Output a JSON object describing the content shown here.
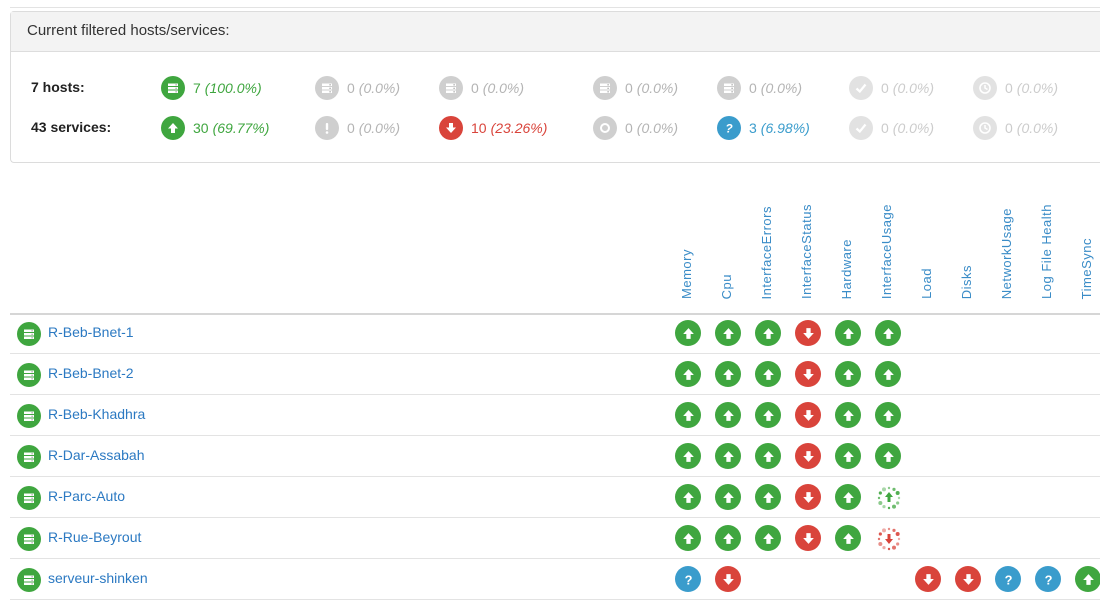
{
  "panel": {
    "heading": "Current filtered hosts/services:",
    "hosts": {
      "label": "7 hosts:",
      "stats": [
        {
          "state": "up",
          "icon": "server-icon",
          "color": "#3fa63f",
          "count": "7",
          "pct": "(100.0%)"
        },
        {
          "state": "down",
          "icon": "server-icon",
          "color": "#cfcfcf",
          "count": "0",
          "pct": "(0.0%)"
        },
        {
          "state": "unreachable",
          "icon": "server-icon",
          "color": "#cfcfcf",
          "count": "0",
          "pct": "(0.0%)"
        },
        {
          "state": "pending",
          "icon": "server-icon",
          "color": "#cfcfcf",
          "count": "0",
          "pct": "(0.0%)"
        },
        {
          "state": "unknown",
          "icon": "server-icon",
          "color": "#cfcfcf",
          "count": "0",
          "pct": "(0.0%)"
        },
        {
          "state": "ack",
          "icon": "check-icon",
          "color": "#e2e2e2",
          "count": "0",
          "pct": "(0.0%)"
        },
        {
          "state": "downtime",
          "icon": "clock-icon",
          "color": "#e2e2e2",
          "count": "0",
          "pct": "(0.0%)"
        }
      ]
    },
    "services": {
      "label": "43 services:",
      "stats": [
        {
          "state": "ok",
          "icon": "arrow-up-icon",
          "color": "#3fa63f",
          "count": "30",
          "pct": "(69.77%)"
        },
        {
          "state": "warning",
          "icon": "exclamation-icon",
          "color": "#cfcfcf",
          "count": "0",
          "pct": "(0.0%)"
        },
        {
          "state": "critical",
          "icon": "arrow-down-icon",
          "color": "#d9443b",
          "count": "10",
          "pct": "(23.26%)"
        },
        {
          "state": "pending",
          "icon": "ring-icon",
          "color": "#cfcfcf",
          "count": "0",
          "pct": "(0.0%)"
        },
        {
          "state": "unknown",
          "icon": "question-icon",
          "color": "#3a9ccc",
          "count": "3",
          "pct": "(6.98%)"
        },
        {
          "state": "ack",
          "icon": "check-icon",
          "color": "#e2e2e2",
          "count": "0",
          "pct": "(0.0%)"
        },
        {
          "state": "downtime",
          "icon": "clock-icon",
          "color": "#e2e2e2",
          "count": "0",
          "pct": "(0.0%)"
        }
      ]
    }
  },
  "columns": [
    "Memory",
    "Cpu",
    "InterfaceErrors",
    "InterfaceStatus",
    "Hardware",
    "InterfaceUsage",
    "Load",
    "Disks",
    "NetworkUsage",
    "Log File Health",
    "TimeSync"
  ],
  "hosts": [
    {
      "name": "R-Beb-Bnet-1",
      "states": [
        "ok",
        "ok",
        "ok",
        "critical",
        "ok",
        "ok",
        null,
        null,
        null,
        null,
        null
      ]
    },
    {
      "name": "R-Beb-Bnet-2",
      "states": [
        "ok",
        "ok",
        "ok",
        "critical",
        "ok",
        "ok",
        null,
        null,
        null,
        null,
        null
      ]
    },
    {
      "name": "R-Beb-Khadhra",
      "states": [
        "ok",
        "ok",
        "ok",
        "critical",
        "ok",
        "ok",
        null,
        null,
        null,
        null,
        null
      ]
    },
    {
      "name": "R-Dar-Assabah",
      "states": [
        "ok",
        "ok",
        "ok",
        "critical",
        "ok",
        "ok",
        null,
        null,
        null,
        null,
        null
      ]
    },
    {
      "name": "R-Parc-Auto",
      "states": [
        "ok",
        "ok",
        "ok",
        "critical",
        "ok",
        "flapping-ok",
        null,
        null,
        null,
        null,
        null
      ]
    },
    {
      "name": "R-Rue-Beyrout",
      "states": [
        "ok",
        "ok",
        "ok",
        "critical",
        "ok",
        "flapping-critical",
        null,
        null,
        null,
        null,
        null
      ]
    },
    {
      "name": "serveur-shinken",
      "states": [
        "unknown",
        "critical",
        null,
        null,
        null,
        null,
        "critical",
        "critical",
        "unknown",
        "unknown",
        "ok"
      ]
    }
  ]
}
